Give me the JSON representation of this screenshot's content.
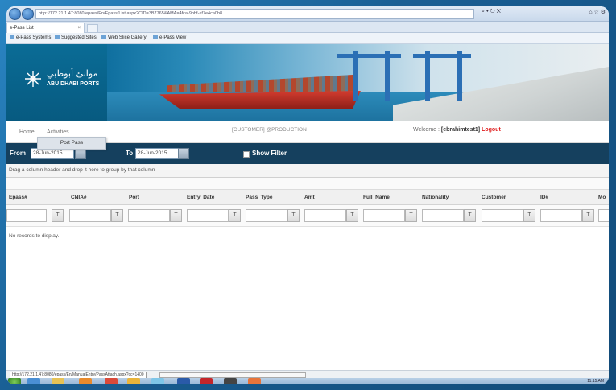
{
  "browser": {
    "url": "http://172.21.1.47:8080/epass/En/Epass/List.aspx?CID=3B7765&AMA=4fca-9bbf-af7e4ca0b8",
    "tools": "⌕ ▾ ↻ ✕",
    "window_controls": "⌂ ☆ ⚙",
    "tab_title": "e-Pass List",
    "tab_close": "×",
    "favorites": [
      {
        "label": "e-Pass Systems"
      },
      {
        "label": "Suggested Sites"
      },
      {
        "label": "Web Slice Gallery"
      },
      {
        "label": "e-Pass View"
      }
    ]
  },
  "banner": {
    "logo_arabic": "موانئ أبوظبي",
    "logo_english": "ABU DHABI PORTS"
  },
  "menu": {
    "home": "Home",
    "activities": "Activities",
    "environment": "[CUSTOMER] @PRODUCTION",
    "welcome": "Welcome :",
    "user": "[ebrahimtest1]",
    "logout": "Logout",
    "dropdown_item": "Port Pass"
  },
  "filter": {
    "from_label": "From",
    "from_value": "28-Jun-2015",
    "to_label": "To",
    "to_value": "28-Jun-2015",
    "show_filter_label": "Show Filter"
  },
  "grid": {
    "group_hint": "Drag a column header and drop it here to group by that column",
    "columns": [
      "Epass#",
      "CNIA#",
      "Port",
      "Entry_Date",
      "Pass_Type",
      "Amt",
      "Full_Name",
      "Nationality",
      "Customer",
      "ID#",
      "Mo"
    ],
    "filter_button": "T",
    "empty_message": "No records to display."
  },
  "status": {
    "link": "http://172.21.1.47:8080/epass/En/ManualEntry/PassAttach.aspx?cc=1400",
    "clock": "11:15 AM"
  }
}
